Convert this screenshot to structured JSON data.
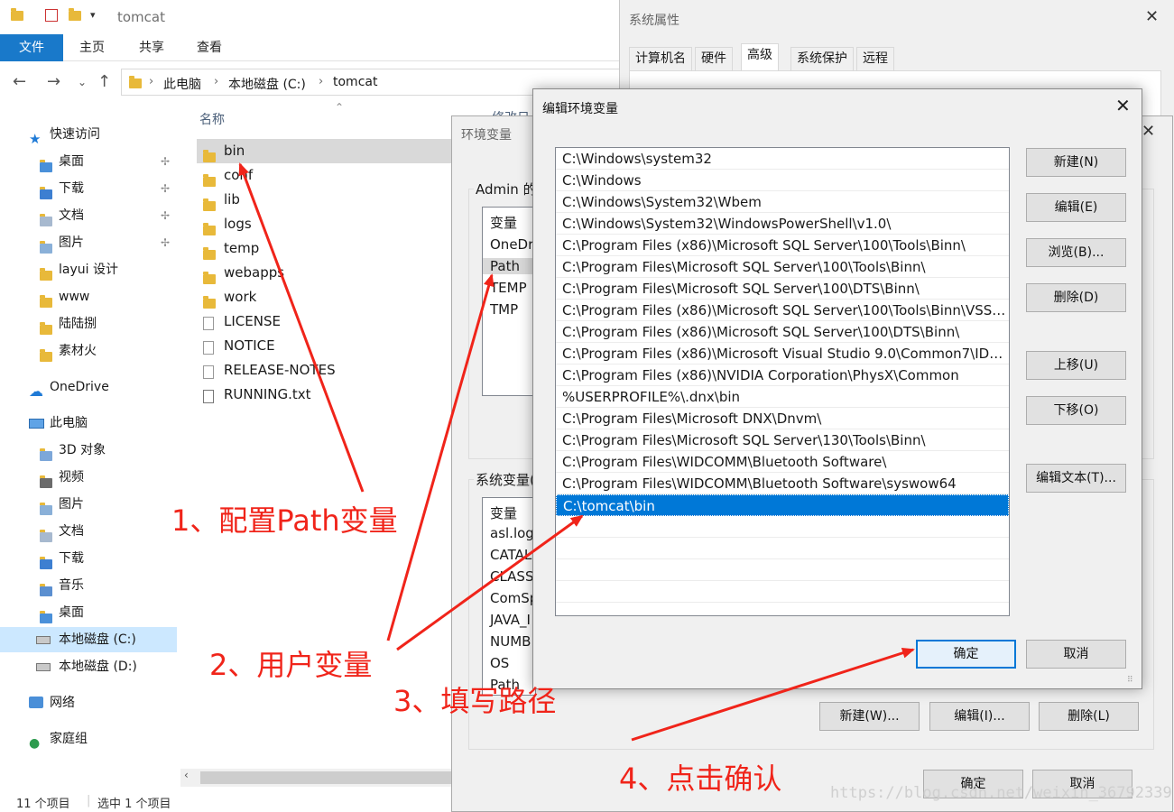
{
  "explorer": {
    "title": "tomcat",
    "ribbon_tabs": [
      "文件",
      "主页",
      "共享",
      "查看"
    ],
    "breadcrumb": [
      "此电脑",
      "本地磁盘 (C:)",
      "tomcat"
    ],
    "nav_items": [
      {
        "label": "快速访问",
        "icon": "star-icon"
      },
      {
        "label": "桌面",
        "icon": "desktop-folder-icon",
        "pinned": true
      },
      {
        "label": "下载",
        "icon": "download-folder-icon",
        "pinned": true
      },
      {
        "label": "文档",
        "icon": "documents-folder-icon",
        "pinned": true
      },
      {
        "label": "图片",
        "icon": "pictures-folder-icon",
        "pinned": true
      },
      {
        "label": "layui 设计",
        "icon": "folder-icon"
      },
      {
        "label": "www",
        "icon": "folder-icon"
      },
      {
        "label": "陆陆捌",
        "icon": "folder-icon"
      },
      {
        "label": "素材火",
        "icon": "folder-icon"
      },
      {
        "label": "OneDrive",
        "icon": "cloud-icon"
      },
      {
        "label": "此电脑",
        "icon": "computer-icon"
      },
      {
        "label": "3D 对象",
        "icon": "3d-objects-icon"
      },
      {
        "label": "视频",
        "icon": "videos-icon"
      },
      {
        "label": "图片",
        "icon": "pictures-folder-icon"
      },
      {
        "label": "文档",
        "icon": "documents-folder-icon"
      },
      {
        "label": "下载",
        "icon": "download-folder-icon"
      },
      {
        "label": "音乐",
        "icon": "music-icon"
      },
      {
        "label": "桌面",
        "icon": "desktop-folder-icon"
      },
      {
        "label": "本地磁盘 (C:)",
        "icon": "drive-icon",
        "selected": true
      },
      {
        "label": "本地磁盘 (D:)",
        "icon": "drive-icon"
      },
      {
        "label": "网络",
        "icon": "network-icon"
      },
      {
        "label": "家庭组",
        "icon": "homegroup-icon"
      }
    ],
    "column_name": "名称",
    "column_modified": "修改日",
    "files": [
      {
        "name": "bin",
        "type": "folder",
        "selected": true
      },
      {
        "name": "conf",
        "type": "folder"
      },
      {
        "name": "lib",
        "type": "folder"
      },
      {
        "name": "logs",
        "type": "folder"
      },
      {
        "name": "temp",
        "type": "folder"
      },
      {
        "name": "webapps",
        "type": "folder"
      },
      {
        "name": "work",
        "type": "folder"
      },
      {
        "name": "LICENSE",
        "type": "file"
      },
      {
        "name": "NOTICE",
        "type": "file"
      },
      {
        "name": "RELEASE-NOTES",
        "type": "file"
      },
      {
        "name": "RUNNING.txt",
        "type": "file"
      }
    ],
    "status_count": "11 个项目",
    "status_selected": "选中 1 个项目"
  },
  "sysprops": {
    "title": "系统属性",
    "tabs": [
      "计算机名",
      "硬件",
      "高级",
      "系统保护",
      "远程"
    ],
    "active_tab": "高级"
  },
  "envvars": {
    "title": "环境变量",
    "user_group_label": "Admin 的",
    "user_header": "变量",
    "user_vars": [
      "OneDr",
      "Path",
      "TEMP",
      "TMP"
    ],
    "system_group_label": "系统变量(",
    "system_header": "变量",
    "system_vars": [
      "asl.log",
      "CATAL",
      "CLASS",
      "ComSp",
      "JAVA_I",
      "NUMB",
      "OS",
      "Path"
    ],
    "buttons": [
      "新建(W)...",
      "编辑(I)...",
      "删除(L)"
    ],
    "ok": "确定",
    "cancel": "取消"
  },
  "edit_dialog": {
    "title": "编辑环境变量",
    "entries": [
      "C:\\Windows\\system32",
      "C:\\Windows",
      "C:\\Windows\\System32\\Wbem",
      "C:\\Windows\\System32\\WindowsPowerShell\\v1.0\\",
      "C:\\Program Files (x86)\\Microsoft SQL Server\\100\\Tools\\Binn\\",
      "C:\\Program Files\\Microsoft SQL Server\\100\\Tools\\Binn\\",
      "C:\\Program Files\\Microsoft SQL Server\\100\\DTS\\Binn\\",
      "C:\\Program Files (x86)\\Microsoft SQL Server\\100\\Tools\\Binn\\VSSh...",
      "C:\\Program Files (x86)\\Microsoft SQL Server\\100\\DTS\\Binn\\",
      "C:\\Program Files (x86)\\Microsoft Visual Studio 9.0\\Common7\\IDE\\...",
      "C:\\Program Files (x86)\\NVIDIA Corporation\\PhysX\\Common",
      "%USERPROFILE%\\.dnx\\bin",
      "C:\\Program Files\\Microsoft DNX\\Dnvm\\",
      "C:\\Program Files\\Microsoft SQL Server\\130\\Tools\\Binn\\",
      "C:\\Program Files\\WIDCOMM\\Bluetooth Software\\",
      "C:\\Program Files\\WIDCOMM\\Bluetooth Software\\syswow64",
      "C:\\tomcat\\bin"
    ],
    "selected_index": 16,
    "buttons": {
      "new": "新建(N)",
      "edit": "编辑(E)",
      "browse": "浏览(B)...",
      "delete": "删除(D)",
      "move_up": "上移(U)",
      "move_down": "下移(O)",
      "edit_text": "编辑文本(T)...",
      "ok": "确定",
      "cancel": "取消"
    }
  },
  "annotations": {
    "step1": "1、配置Path变量",
    "step2": "2、用户变量",
    "step3": "3、填写路径",
    "step4": "4、点击确认",
    "color": "#f0241a"
  },
  "watermark": "https://blog.csdn.net/weixin_36792339"
}
